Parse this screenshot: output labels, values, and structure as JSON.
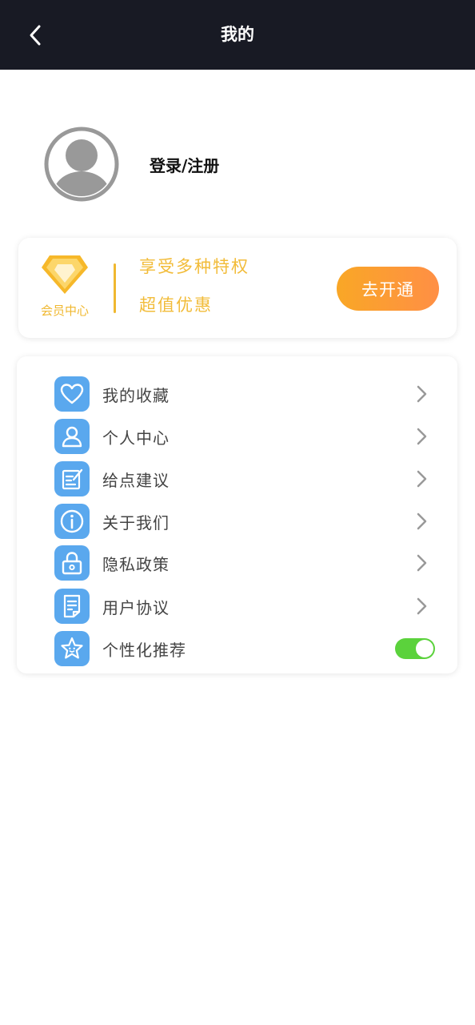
{
  "header": {
    "title": "我的",
    "back_icon": "chevron-left-icon"
  },
  "profile": {
    "avatar_icon": "user-avatar-icon",
    "login_label": "登录/注册"
  },
  "vip": {
    "icon": "diamond-icon",
    "label": "会员中心",
    "line1": "享受多种特权",
    "line2": "超值优惠",
    "button_label": "去开通",
    "accent_color": "#f0b830"
  },
  "menu": {
    "items": [
      {
        "label": "我的收藏",
        "icon": "heart-icon"
      },
      {
        "label": "个人中心",
        "icon": "user-icon"
      },
      {
        "label": "给点建议",
        "icon": "edit-note-icon"
      },
      {
        "label": "关于我们",
        "icon": "info-icon"
      },
      {
        "label": "隐私政策",
        "icon": "lock-icon"
      },
      {
        "label": "用户协议",
        "icon": "document-icon"
      }
    ],
    "toggle_item": {
      "label": "个性化推荐",
      "icon": "star-face-icon",
      "enabled": true
    },
    "icon_color": "#5aa8ee",
    "toggle_color": "#5bd23c"
  }
}
